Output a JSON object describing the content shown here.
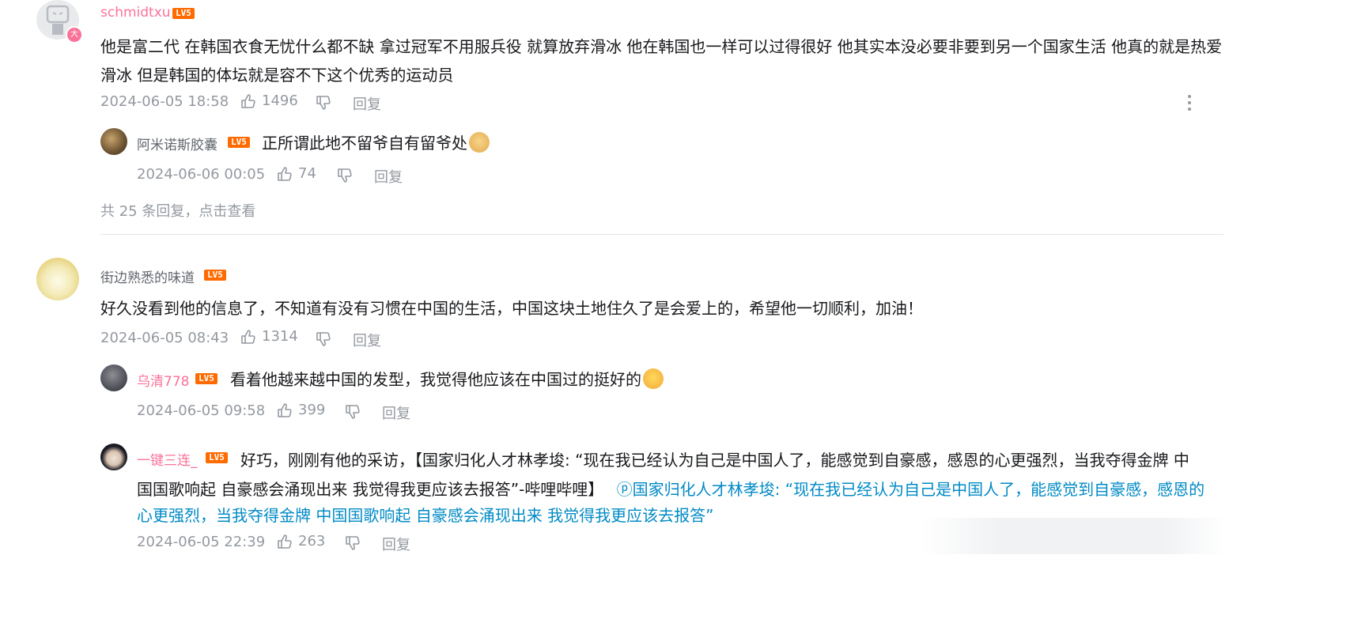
{
  "comments": [
    {
      "user": "schmidtxu",
      "level": "LV5",
      "avatar_badge": "大",
      "text": "他是富二代 在韩国衣食无忧什么都不缺 拿过冠军不用服兵役 就算放弃滑冰 他在韩国也一样可以过得很好 他其实本没必要非要到另一个国家生活 他真的就是热爱滑冰 但是韩国的体坛就是容不下这个优秀的运动员",
      "time": "2024-06-05 18:58",
      "likes": "1496",
      "reply_label": "回复",
      "replies": [
        {
          "user": "阿米诺斯胶囊",
          "level": "LV5",
          "text": "正所谓此地不留爷自有留爷处",
          "time": "2024-06-06 00:05",
          "likes": "74",
          "reply_label": "回复"
        }
      ],
      "view_more": "共 25 条回复，点击查看"
    },
    {
      "user": "街边熟悉的味道",
      "level": "LV5",
      "text": "好久没看到他的信息了，不知道有没有习惯在中国的生活，中国这块土地住久了是会爱上的，希望他一切顺利，加油！",
      "time": "2024-06-05 08:43",
      "likes": "1314",
      "reply_label": "回复",
      "replies": [
        {
          "user": "乌清778",
          "level": "LV5",
          "text": "看着他越来越中国的发型，我觉得他应该在中国过的挺好的",
          "time": "2024-06-05 09:58",
          "likes": "399",
          "reply_label": "回复"
        },
        {
          "user": "一键三连_",
          "level": "LV5",
          "text_line1": "好巧，刚刚有他的采访，【国家归化人才林孝埈: “现在我已经认为自己是中国人了，能感觉到自豪感，感恩的心更强烈，当我夺得金牌 中",
          "text_line2": "国国歌响起 自豪感会涌现出来 我觉得我更应该去报答”-哔哩哔哩】",
          "link_line2": "ⓟ国家归化人才林孝埈: “现在我已经认为自己是中国人了，能感觉到自豪感，感恩的",
          "link_line3": "心更强烈，当我夺得金牌 中国国歌响起 自豪感会涌现出来 我觉得我更应该去报答”",
          "time": "2024-06-05 22:39",
          "likes": "263",
          "reply_label": "回复"
        }
      ]
    }
  ],
  "colors": {
    "accent_pink": "#fb7299",
    "link_blue": "#008ac5",
    "meta_gray": "#9499a0",
    "level_orange": "#ff6b00"
  }
}
